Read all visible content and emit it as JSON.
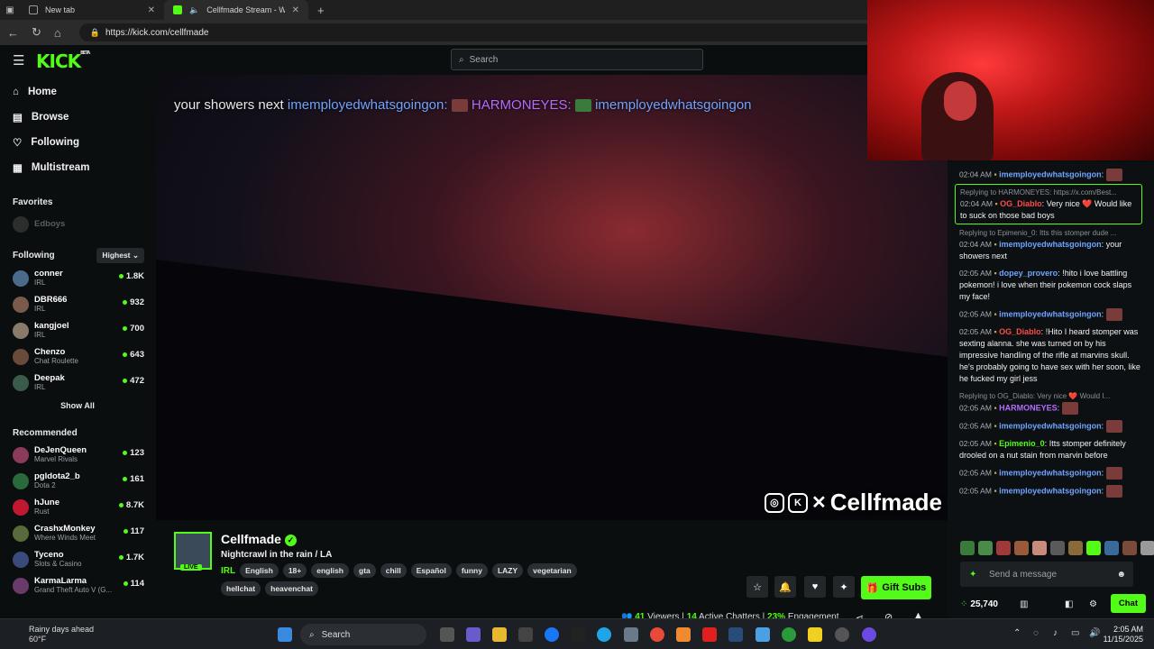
{
  "browser": {
    "tabs": [
      {
        "title": "New tab",
        "active": false
      },
      {
        "title": "Cellfmade Stream - Watch L",
        "active": true
      }
    ],
    "url": "https://kick.com/cellfmade"
  },
  "site": {
    "logo": "KICK",
    "logo_sup": "BETA",
    "search_placeholder": "Search",
    "nav": [
      {
        "label": "Home",
        "icon": "home-icon"
      },
      {
        "label": "Browse",
        "icon": "browse-icon"
      },
      {
        "label": "Following",
        "icon": "heart-icon"
      },
      {
        "label": "Multistream",
        "icon": "grid-icon"
      }
    ],
    "favorites_title": "Favorites",
    "favorites": [
      {
        "name": "Edboys"
      }
    ],
    "following_title": "Following",
    "following_sort": "Highest",
    "following": [
      {
        "name": "conner",
        "category": "IRL",
        "viewers": "1.8K",
        "color": "#4a6a8a"
      },
      {
        "name": "DBR666",
        "category": "IRL",
        "viewers": "932",
        "color": "#7a5a4a"
      },
      {
        "name": "kangjoel",
        "category": "IRL",
        "viewers": "700",
        "color": "#8a7a6a"
      },
      {
        "name": "Chenzo",
        "category": "Chat Roulette",
        "viewers": "643",
        "color": "#6a4a3a"
      },
      {
        "name": "Deepak",
        "category": "IRL",
        "viewers": "472",
        "color": "#3a5a4a"
      }
    ],
    "show_all": "Show All",
    "recommended_title": "Recommended",
    "recommended": [
      {
        "name": "DeJenQueen",
        "category": "Marvel Rivals",
        "viewers": "123",
        "color": "#8a3a5a"
      },
      {
        "name": "pgldota2_b",
        "category": "Dota 2",
        "viewers": "161",
        "color": "#2a6a3a"
      },
      {
        "name": "hJune",
        "category": "Rust",
        "viewers": "8.7K",
        "color": "#c01830"
      },
      {
        "name": "CrashxMonkey",
        "category": "Where Winds Meet",
        "viewers": "117",
        "color": "#5a6a3a"
      },
      {
        "name": "Tyceno",
        "category": "Slots & Casino",
        "viewers": "1.7K",
        "color": "#3a4a7a"
      },
      {
        "name": "KarmaLarma",
        "category": "Grand Theft Auto V (G...",
        "viewers": "114",
        "color": "#6a3a6a"
      }
    ]
  },
  "player": {
    "overlay_text_1": "your showers next",
    "overlay_user_1": "imemployedwhatsgoingon:",
    "overlay_user_2": "HARMONEYES:",
    "overlay_user_3": "imemployedwhatsgoingon",
    "watermark": "Cellfmade"
  },
  "stream": {
    "streamer": "Cellfmade",
    "live_label": "LIVE",
    "title": "Nightcrawl in the rain / LA",
    "category": "IRL",
    "tags": [
      "English",
      "18+",
      "english",
      "gta",
      "chill",
      "Español",
      "funny",
      "LAZY",
      "vegetarian",
      "hellchat",
      "heavenchat"
    ],
    "gift_label": "Gift Subs",
    "viewers": "41",
    "viewers_label": "Viewers",
    "chatters": "14",
    "chatters_label": "Active Chatters",
    "engagement": "23%",
    "engagement_label": "Engagement"
  },
  "chat": {
    "messages": [
      {
        "reply": "",
        "time": "02:04 AM",
        "user": "imemployedwhatsgoingon",
        "color": "#6fa4ff",
        "text": ""
      },
      {
        "reply": "Replying to HARMONEYES: https://x.com/Best...",
        "time": "02:04 AM",
        "user": "OG_Diablo",
        "color": "#ff4a4a",
        "text": "Very nice ❤️ Would like to suck on those bad boys",
        "highlight": true
      },
      {
        "reply": "Replying to Epimenio_0: Itts this stomper dude ...",
        "time": "02:04 AM",
        "user": "imemployedwhatsgoingon",
        "color": "#6fa4ff",
        "text": "your showers next"
      },
      {
        "reply": "",
        "time": "02:05 AM",
        "user": "dopey_provero",
        "color": "#6fa4ff",
        "text": "!hito i love battling pokemon! i love when their pokemon cock slaps my face!"
      },
      {
        "reply": "",
        "time": "02:05 AM",
        "user": "imemployedwhatsgoingon",
        "color": "#6fa4ff",
        "text": ""
      },
      {
        "reply": "",
        "time": "02:05 AM",
        "user": "OG_Diablo",
        "color": "#ff4a4a",
        "text": "!Hito I heard stomper was sexting alanna. she was turned on by his impressive handling of the rifle at marvins skull. he's probably going to have sex with her soon, like he fucked my girl jess"
      },
      {
        "reply": "Replying to OG_Diablo: Very nice ❤️ Would I...",
        "time": "02:05 AM",
        "user": "HARMONEYES",
        "color": "#b56bff",
        "text": ""
      },
      {
        "reply": "",
        "time": "02:05 AM",
        "user": "imemployedwhatsgoingon",
        "color": "#6fa4ff",
        "text": ""
      },
      {
        "reply": "",
        "time": "02:05 AM",
        "user": "Epimenio_0",
        "color": "#53fc18",
        "text": "Itts stomper definitely drooled on a nut stain from marvin before"
      },
      {
        "reply": "",
        "time": "02:05 AM",
        "user": "imemployedwhatsgoingon",
        "color": "#6fa4ff",
        "text": ""
      },
      {
        "reply": "",
        "time": "02:05 AM",
        "user": "imemployedwhatsgoingon",
        "color": "#6fa4ff",
        "text": ""
      }
    ],
    "input_placeholder": "Send a message",
    "points": "25,740",
    "chat_button": "Chat"
  },
  "taskbar": {
    "weather_title": "Rainy days ahead",
    "weather_temp": "60°F",
    "search_label": "Search",
    "time": "2:05 AM",
    "date": "11/15/2025"
  }
}
